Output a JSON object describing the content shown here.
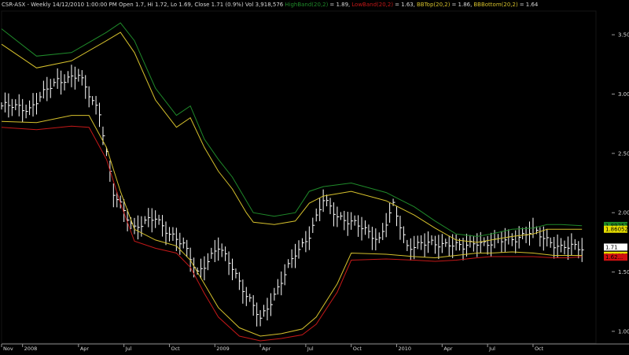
{
  "header": {
    "title": "CSR-ASX - Weekly 14/12/2010 1:00:00 PM Open 1.7, Hi 1.72, Lo 1.69, Close 1.71 (0.9%) Vol 3,918,576",
    "high_band": {
      "label": "HighBand(20,2)",
      "value": "= 1.89,"
    },
    "low_band": {
      "label": "LowBand(20,2)",
      "value": "= 1.63,"
    },
    "bb_top": {
      "label": "BBTop(20,2)",
      "value": "= 1.86,"
    },
    "bb_bottom": {
      "label": "BBBottom(20,2)",
      "value": "= 1.64"
    }
  },
  "colors": {
    "background": "#000000",
    "price": "#ffffff",
    "high_band": "#1f8a2a",
    "low_band": "#c41818",
    "bb": "#d6c12c",
    "text": "#d8d8d8"
  },
  "chart_data": {
    "type": "line",
    "title": "",
    "xlabel": "",
    "ylabel": "",
    "x_ticks": [
      "Nov",
      "2008",
      "Apr",
      "Jul",
      "Oct",
      "2009",
      "Apr",
      "Jul",
      "Oct",
      "2010",
      "Apr",
      "Jul",
      "Oct"
    ],
    "x_tick_weeks": [
      0,
      6,
      22,
      35,
      48,
      61,
      74,
      87,
      100,
      113,
      126,
      139,
      152
    ],
    "y_ticks": [
      1.0,
      1.5,
      2.0,
      2.5,
      3.0,
      3.5
    ],
    "ylim": [
      0.9,
      3.7
    ],
    "xlim": [
      0,
      170
    ],
    "last_value_tags": [
      {
        "label": "1.89252",
        "value": 1.89252,
        "series": "HighBand(20,2)"
      },
      {
        "label": "1.86052",
        "value": 1.86052,
        "series": "BBTop(20,2)"
      },
      {
        "label": "1.71",
        "value": 1.71,
        "series": "Close"
      },
      {
        "label": "1.64138",
        "value": 1.64138,
        "series": "BBBottom(20,2)"
      },
      {
        "label": "1.62...",
        "value": 1.625,
        "series": "LowBand(20,2)"
      }
    ],
    "series": [
      {
        "name": "Close",
        "key": "close",
        "color": "#ffffff",
        "x": [
          0,
          8,
          16,
          22,
          28,
          32,
          38,
          44,
          52,
          56,
          62,
          66,
          70,
          74,
          80,
          84,
          88,
          92,
          96,
          100,
          104,
          108,
          112,
          116,
          120,
          124,
          128,
          132,
          136,
          140,
          144,
          148,
          152,
          156,
          160,
          164,
          166
        ],
        "y": [
          2.9,
          2.88,
          3.12,
          3.15,
          2.85,
          2.15,
          1.88,
          1.95,
          1.72,
          1.5,
          1.7,
          1.55,
          1.3,
          1.1,
          1.42,
          1.65,
          1.82,
          2.1,
          1.98,
          1.92,
          1.85,
          1.78,
          2.05,
          1.72,
          1.74,
          1.73,
          1.75,
          1.7,
          1.76,
          1.74,
          1.77,
          1.8,
          1.84,
          1.78,
          1.7,
          1.71,
          1.71
        ]
      },
      {
        "name": "HighBand(20,2)",
        "key": "high_band",
        "color": "#1f8a2a",
        "x": [
          0,
          10,
          20,
          30,
          34,
          38,
          44,
          50,
          54,
          58,
          62,
          66,
          70,
          72,
          78,
          84,
          88,
          92,
          100,
          110,
          118,
          124,
          130,
          136,
          140,
          146,
          152,
          156,
          160,
          166
        ],
        "y": [
          3.55,
          3.32,
          3.35,
          3.52,
          3.6,
          3.45,
          3.05,
          2.82,
          2.9,
          2.62,
          2.45,
          2.3,
          2.1,
          2.0,
          1.97,
          2.0,
          2.18,
          2.22,
          2.25,
          2.17,
          2.05,
          1.93,
          1.82,
          1.8,
          1.82,
          1.86,
          1.87,
          1.9,
          1.9,
          1.89
        ]
      },
      {
        "name": "BBTop(20,2)",
        "key": "bb_top",
        "color": "#d6c12c",
        "x": [
          0,
          10,
          20,
          30,
          34,
          38,
          44,
          50,
          54,
          58,
          62,
          66,
          70,
          72,
          78,
          84,
          88,
          92,
          100,
          110,
          118,
          124,
          130,
          136,
          140,
          146,
          152,
          156,
          160,
          166
        ],
        "y": [
          3.42,
          3.22,
          3.28,
          3.45,
          3.52,
          3.35,
          2.95,
          2.72,
          2.8,
          2.55,
          2.35,
          2.2,
          2.0,
          1.92,
          1.9,
          1.93,
          2.08,
          2.14,
          2.18,
          2.1,
          1.98,
          1.87,
          1.77,
          1.75,
          1.77,
          1.8,
          1.82,
          1.86,
          1.86,
          1.86
        ]
      },
      {
        "name": "BBBottom(20,2)",
        "key": "bb_bottom",
        "color": "#d6c12c",
        "x": [
          0,
          10,
          20,
          25,
          30,
          34,
          38,
          44,
          50,
          54,
          58,
          62,
          68,
          74,
          80,
          86,
          90,
          96,
          100,
          110,
          118,
          124,
          130,
          136,
          140,
          146,
          152,
          158,
          162,
          166
        ],
        "y": [
          2.77,
          2.76,
          2.82,
          2.82,
          2.55,
          2.18,
          1.86,
          1.77,
          1.72,
          1.6,
          1.4,
          1.2,
          1.03,
          0.96,
          0.98,
          1.02,
          1.12,
          1.4,
          1.66,
          1.65,
          1.63,
          1.62,
          1.64,
          1.66,
          1.66,
          1.67,
          1.66,
          1.64,
          1.64,
          1.64
        ]
      },
      {
        "name": "LowBand(20,2)",
        "key": "low_band",
        "color": "#c41818",
        "x": [
          0,
          10,
          20,
          25,
          30,
          34,
          38,
          44,
          50,
          54,
          58,
          62,
          68,
          74,
          80,
          86,
          90,
          96,
          100,
          110,
          118,
          124,
          130,
          136,
          140,
          146,
          152,
          158,
          162,
          166
        ],
        "y": [
          2.72,
          2.7,
          2.73,
          2.72,
          2.45,
          2.08,
          1.76,
          1.7,
          1.66,
          1.54,
          1.32,
          1.12,
          0.96,
          0.92,
          0.94,
          0.97,
          1.06,
          1.33,
          1.6,
          1.61,
          1.6,
          1.59,
          1.6,
          1.62,
          1.63,
          1.63,
          1.63,
          1.62,
          1.62,
          1.63
        ]
      }
    ]
  }
}
